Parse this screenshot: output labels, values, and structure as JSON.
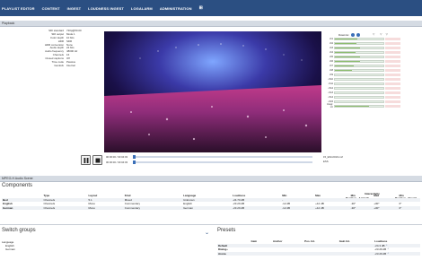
{
  "nav": {
    "items": [
      "PLAYLIST EDITOR",
      "CONTENT",
      "INGEST",
      "LOUDNESS INGEST",
      "LOGALARM",
      "ADMINISTRATION"
    ],
    "grid_icon": "⊞"
  },
  "playback": {
    "section_title": "Playback",
    "info": [
      {
        "key": "SDI standard",
        "value": "720p@50.00"
      },
      {
        "key": "SDI output",
        "value": "Mode 1"
      },
      {
        "key": "Color depth",
        "value": "10 bits"
      },
      {
        "key": "HDR",
        "value": "SDR"
      },
      {
        "key": "HDR conversion",
        "value": "None"
      },
      {
        "key": "Audio depth",
        "value": "24 bits"
      },
      {
        "key": "Audio frequency",
        "value": "48000 Hz"
      },
      {
        "key": "Channels",
        "value": "16"
      },
      {
        "key": "Closed captions",
        "value": "Off"
      },
      {
        "key": "Time code",
        "value": "Passive"
      },
      {
        "key": "Genlock",
        "value": "Internal"
      }
    ],
    "time_current": "00:00:00 / 00:04:03",
    "time_secondary": "00:00:00 / 00:04:03",
    "progress": 0,
    "filename": "15_ESC2019.mxf",
    "fileext": "ESS",
    "loudness_label": "Downmix",
    "meters": [
      {
        "label": "ch1",
        "level": 0.46
      },
      {
        "label": "ch2",
        "level": 0.44
      },
      {
        "label": "ch3",
        "level": 0.52
      },
      {
        "label": "ch4",
        "level": 0.43
      },
      {
        "label": "ch5",
        "level": 0.52
      },
      {
        "label": "ch6",
        "level": 0.52
      },
      {
        "label": "ch7",
        "level": 0.38
      },
      {
        "label": "ch8",
        "level": 0.36
      },
      {
        "label": "ch9",
        "level": 0.0
      },
      {
        "label": "ch10",
        "level": 0.0
      },
      {
        "label": "ch11",
        "level": 0.0
      },
      {
        "label": "ch12",
        "level": 0.0
      },
      {
        "label": "ch13",
        "level": 0.0
      },
      {
        "label": "ch14",
        "level": 0.0
      },
      {
        "label": "ch15",
        "level": 0.0
      },
      {
        "label": "Integr. LU",
        "level": 0.7
      }
    ]
  },
  "mpegh": {
    "section_title": "MPEG-H Audio Scene",
    "components_heading": "Components",
    "interactivity_label": "Interactivity",
    "position_azimuth": "Position - Azimuth",
    "position_elevation": "Position - Elevati",
    "columns": [
      "",
      "Type",
      "Layout",
      "Kind",
      "Language",
      "Loudness",
      "Min",
      "Max",
      "Min",
      "Max",
      "Min"
    ],
    "rows": [
      [
        "Bed",
        "Channels",
        "5.1",
        "Mixed",
        "Unknown",
        "-24.70 dB",
        "-",
        "",
        "",
        "",
        ""
      ],
      [
        "English",
        "Channels",
        "Mono",
        "Commentary",
        "English",
        "-23.29 dB",
        "-12 dB",
        "+12 dB",
        "-30°",
        "+30°",
        "0°"
      ],
      [
        "German",
        "Channels",
        "Mono",
        "Commentary",
        "German",
        "-23.29 dB",
        "-12 dB",
        "+12 dB",
        "-30°",
        "+30°",
        "0°"
      ]
    ],
    "switch_heading": "Switch groups",
    "languages_label": "Language",
    "languages": [
      "English",
      "German"
    ],
    "presets_heading": "Presets",
    "preset_columns": [
      "",
      "Gain",
      "Anchor",
      "Pos. Int.",
      "Gain Int.",
      "Loudness"
    ],
    "presets": [
      {
        "name": "Default",
        "loudness": "-24.3 dB"
      },
      {
        "name": "Dialog+",
        "loudness": "-23.29 dB"
      },
      {
        "name": "Arena",
        "loudness": "-23.29 dB"
      }
    ]
  }
}
